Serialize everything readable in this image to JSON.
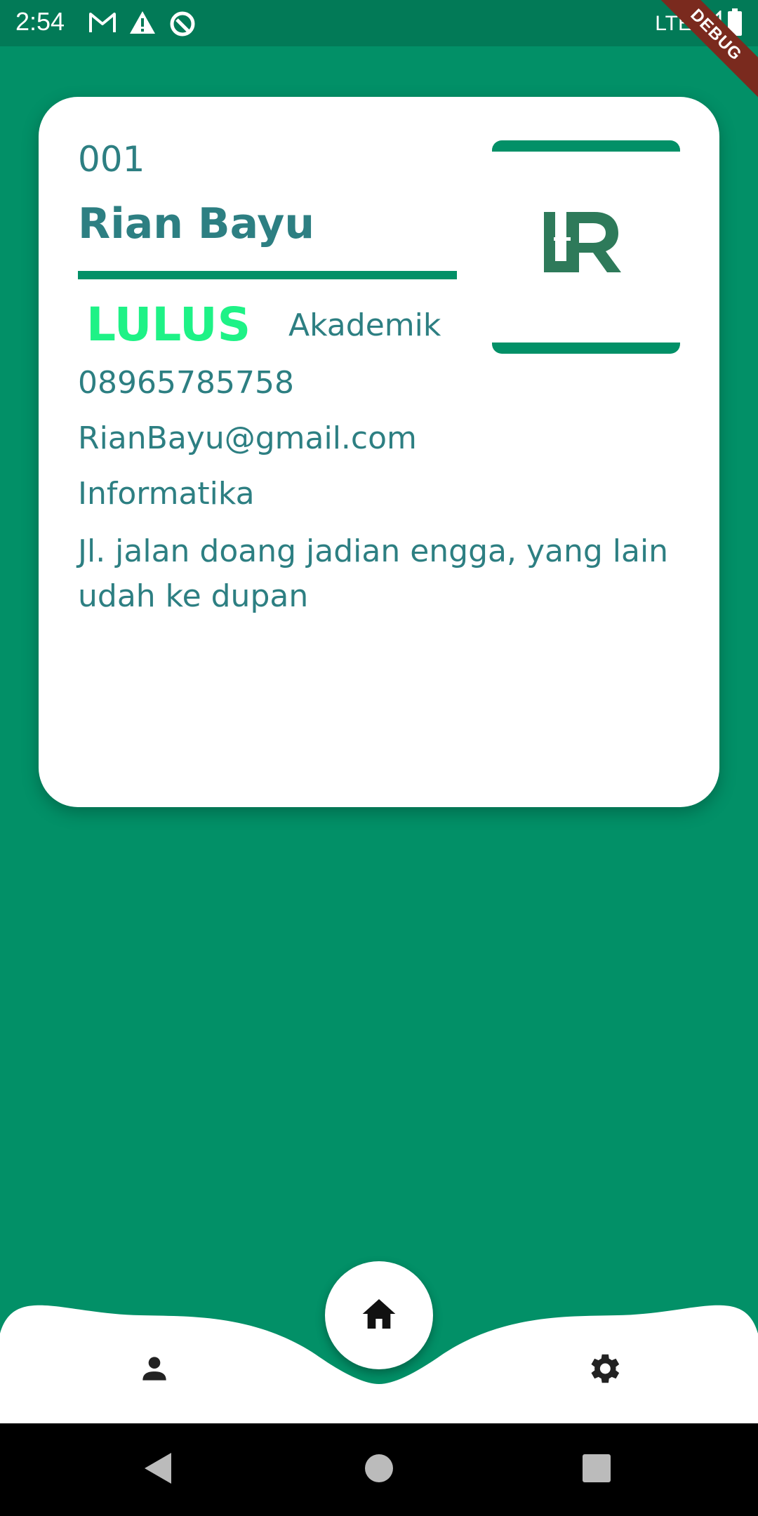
{
  "status_bar": {
    "time": "2:54",
    "network": "LTE",
    "debug_label": "DEBUG",
    "left_icons": [
      "gmail-icon",
      "warning-icon",
      "data-saver-icon"
    ],
    "right_icons": [
      "signal-icon",
      "battery-icon"
    ]
  },
  "card": {
    "id": "001",
    "name": "Rian Bayu",
    "status": "LULUS",
    "category": "Akademik",
    "phone": "08965785758",
    "email": "RianBayu@gmail.com",
    "major": "Informatika",
    "address": "Jl. jalan doang jadian engga, yang lain udah ke dupan",
    "logo_letters": "LR"
  },
  "bottom_nav": {
    "items": [
      "person-icon",
      "home-icon",
      "settings-icon"
    ]
  },
  "colors": {
    "background": "#029067",
    "status_bar": "#027a57",
    "text": "#2d7f82",
    "status_green": "#1ef286",
    "logo": "#2e7a5a"
  }
}
